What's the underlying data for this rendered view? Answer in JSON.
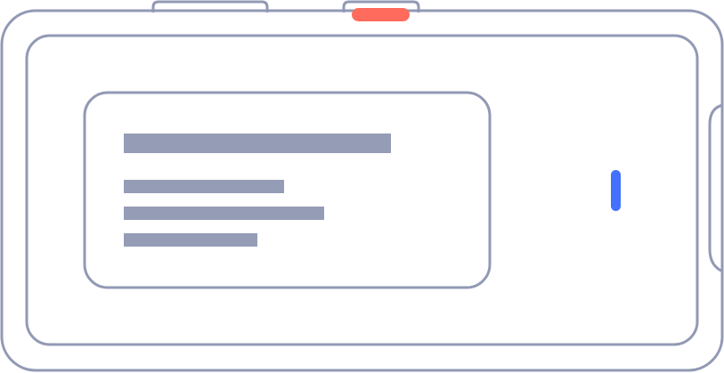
{
  "colors": {
    "outline": "#9299B4",
    "text_placeholder": "#959CB5",
    "power_button": "#FF6B5C",
    "cursor": "#4270FF",
    "background": "#FFFFFF"
  },
  "diagram": {
    "device": "phone-landscape",
    "content_card": {
      "placeholder_lines": [
        {
          "role": "title"
        },
        {
          "role": "text-line"
        },
        {
          "role": "text-line"
        },
        {
          "role": "text-line"
        }
      ]
    },
    "icons": [
      "power-button-icon",
      "cursor-caret-icon",
      "side-button-icon",
      "top-button-icon"
    ]
  }
}
